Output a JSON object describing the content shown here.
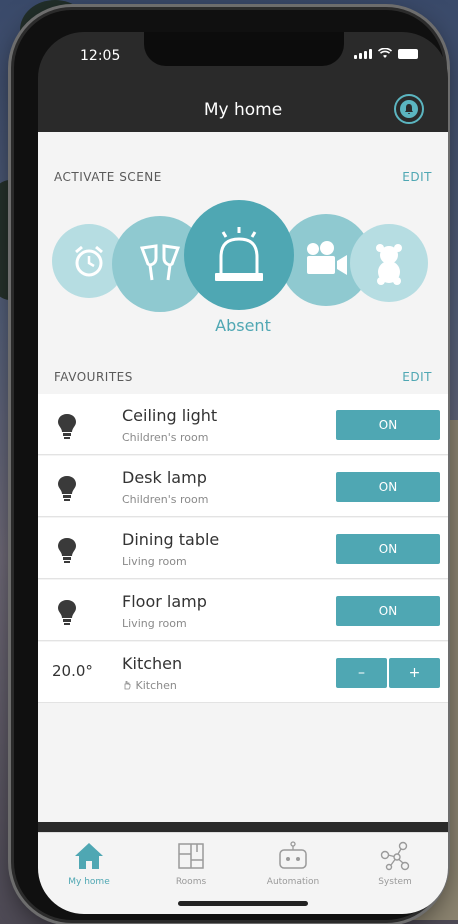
{
  "status_bar": {
    "time": "12:05"
  },
  "header": {
    "title": "My home"
  },
  "scenes": {
    "section_label": "ACTIVATE SCENE",
    "edit_label": "EDIT",
    "items": [
      {
        "icon": "alarm-clock-icon"
      },
      {
        "icon": "wine-glasses-icon"
      },
      {
        "icon": "siren-icon",
        "label": "Absent",
        "active": true
      },
      {
        "icon": "video-camera-icon"
      },
      {
        "icon": "teddy-bear-icon"
      }
    ]
  },
  "favourites": {
    "section_label": "FAVOURITES",
    "edit_label": "EDIT",
    "items": [
      {
        "name": "Ceiling light",
        "room": "Children's room",
        "action": "ON",
        "icon": "bulb-icon"
      },
      {
        "name": "Desk lamp",
        "room": "Children's room",
        "action": "ON",
        "icon": "bulb-icon"
      },
      {
        "name": "Dining table",
        "room": "Living room",
        "action": "ON",
        "icon": "bulb-icon"
      },
      {
        "name": "Floor lamp",
        "room": "Living room",
        "action": "ON",
        "icon": "bulb-icon"
      },
      {
        "name": "Kitchen",
        "room": "Kitchen",
        "temperature": "20.0°",
        "minus": "–",
        "plus": "+",
        "icon": "hand-icon"
      }
    ]
  },
  "tabs": [
    {
      "label": "My home",
      "icon": "home-icon",
      "active": true
    },
    {
      "label": "Rooms",
      "icon": "rooms-icon"
    },
    {
      "label": "Automation",
      "icon": "robot-icon"
    },
    {
      "label": "System",
      "icon": "network-icon"
    }
  ],
  "colors": {
    "accent": "#4fa7b3",
    "header": "#2a2a2a",
    "content_bg": "#f4f4f4"
  }
}
